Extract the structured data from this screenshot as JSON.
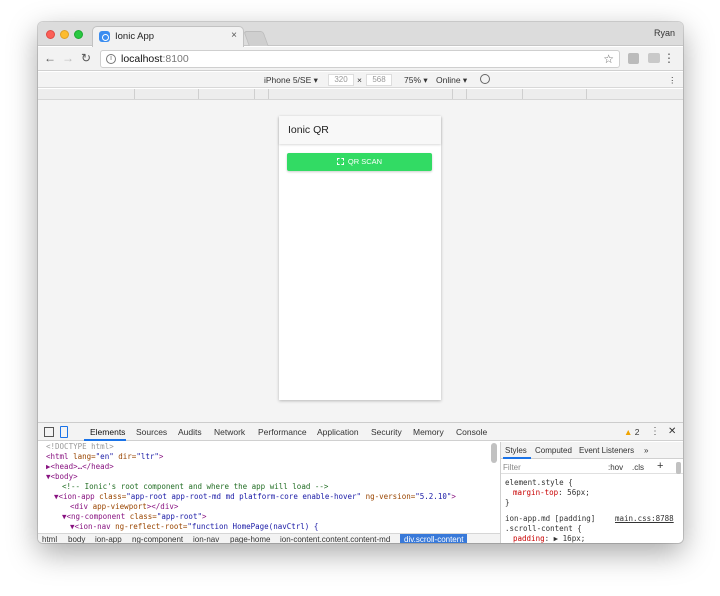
{
  "tab": {
    "title": "Ionic App",
    "close": "×"
  },
  "profile": "Ryan",
  "address": {
    "host": "localhost",
    "port": ":8100"
  },
  "device_toolbar": {
    "device": "iPhone 5/SE ▾",
    "width": "320",
    "times": "×",
    "height": "568",
    "zoom": "75% ▾",
    "network": "Online ▾"
  },
  "app": {
    "title": "Ionic QR",
    "button_label": "QR SCAN"
  },
  "devtools": {
    "tabs": [
      "Elements",
      "Sources",
      "Audits",
      "Network",
      "Performance",
      "Application",
      "Security",
      "Memory",
      "Console"
    ],
    "warnings": "2",
    "dom": {
      "l1": "<!DOCTYPE html>",
      "l2_tag": "<html",
      "l2_attr1": " lang=",
      "l2_val1": "\"en\"",
      "l2_attr2": " dir=",
      "l2_val2": "\"ltr\"",
      "l2_end": ">",
      "l3": "▶<head>…</head>",
      "l4": "▼<body>",
      "l5": "<!-- Ionic's root component and where the app will load -->",
      "l6_tag": "▼<ion-app",
      "l6_attr": " class=",
      "l6_val": "\"app-root app-root-md md platform-core enable-hover\"",
      "l6_attr2": " ng-version=",
      "l6_val2": "\"5.2.10\"",
      "l6_end": ">",
      "l7_tag": "<div",
      "l7_attr": " app-viewport",
      "l7_end": "></div>",
      "l8_tag": "▼<ng-component",
      "l8_attr": " class=",
      "l8_val": "\"app-root\"",
      "l8_end": ">",
      "l9_tag": "▼<ion-nav",
      "l9_attr": " ng-reflect-root=",
      "l9_val": "\"function HomePage(navCtrl) {"
    },
    "styles_tabs": [
      "Styles",
      "Computed",
      "Event Listeners",
      "»"
    ],
    "filter": {
      "label": "Filter",
      "hov": ":hov",
      "cls": ".cls",
      "plus": "+"
    },
    "css": {
      "s1": "element.style {",
      "s1_prop": "margin-top",
      "s1_val": ": 56px;",
      "close": "}",
      "s2_sel": "ion-app.md [padding]",
      "s2_link": "main.css:8788",
      "s2_sel2": ".scroll-content {",
      "s2_prop": "padding",
      "s2_val": ": ▶ 16px;"
    },
    "breadcrumbs": [
      "html",
      "body",
      "ion-app",
      "ng-component",
      "ion-nav",
      "page-home",
      "ion-content.content.content-md",
      "div.scroll-content"
    ]
  }
}
